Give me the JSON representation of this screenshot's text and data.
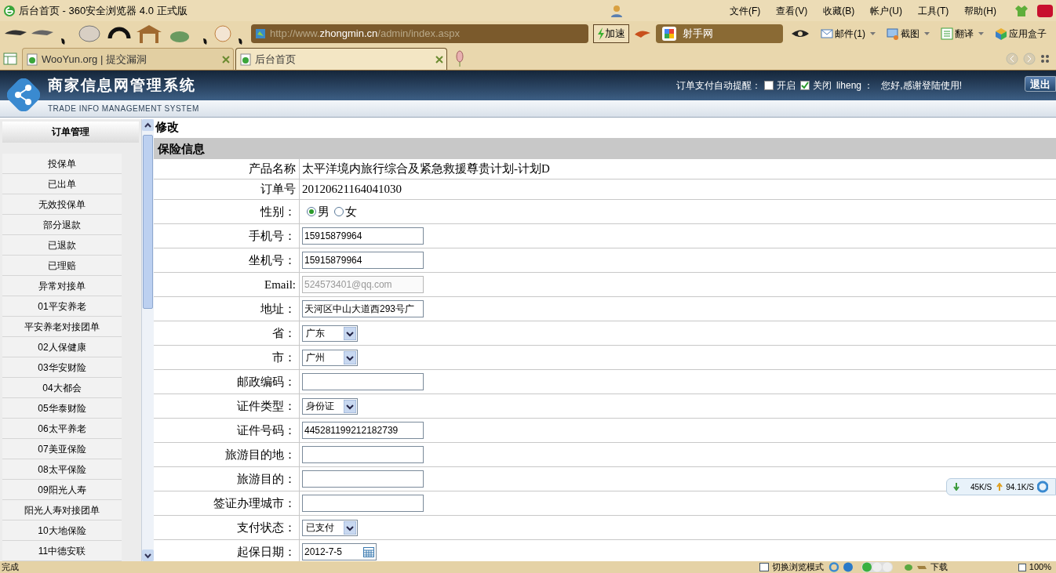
{
  "window": {
    "title": "后台首页 - 360安全浏览器 4.0 正式版"
  },
  "menu": [
    "文件(F)",
    "查看(V)",
    "收藏(B)",
    "帐户(U)",
    "工具(T)",
    "帮助(H)"
  ],
  "toolbar": {
    "address": {
      "prefix": "http://www.",
      "domain": "zhongmin.cn",
      "path": "/admin/index.aspx"
    },
    "speedup": "加速",
    "search": "射手网",
    "tools": [
      {
        "label": "邮件(1)",
        "dropdown": true
      },
      {
        "label": "截图",
        "dropdown": true
      },
      {
        "label": "翻译",
        "dropdown": true
      },
      {
        "label": "应用盒子",
        "dropdown": false
      }
    ]
  },
  "tabs": [
    {
      "label": "WooYun.org | 提交漏洞",
      "selected": false
    },
    {
      "label": "后台首页",
      "selected": true
    }
  ],
  "header": {
    "title": "商家信息网管理系统",
    "subtitle": "TRADE INFO MANAGEMENT SYSTEM",
    "reminder_label": "订单支付自动提醒：",
    "options": [
      {
        "label": "开启",
        "checked": false
      },
      {
        "label": "关闭",
        "checked": true
      }
    ],
    "user": "liheng ：",
    "greeting": "您好,感谢登陆使用!",
    "logout": "退出"
  },
  "sidebar": {
    "title": "订单管理",
    "items": [
      "投保单",
      "已出单",
      "无效投保单",
      "部分退款",
      "已退款",
      "已理赔",
      "异常对接单",
      "01平安养老",
      "平安养老对接团单",
      "02人保健康",
      "03华安财险",
      "04大都会",
      "05华泰财险",
      "06太平养老",
      "07美亚保险",
      "08太平保险",
      "09阳光人寿",
      "阳光人寿对接团单",
      "10大地保险",
      "11中德安联"
    ]
  },
  "main": {
    "title": "修改",
    "section": "保险信息",
    "rows": [
      {
        "kind": "text",
        "label": "产品名称",
        "value": "太平洋境内旅行综合及紧急救援尊贵计划-计划D"
      },
      {
        "kind": "text",
        "label": "订单号",
        "value": "20120621164041030"
      },
      {
        "kind": "radio",
        "label": "性别：",
        "options": [
          {
            "label": "男",
            "selected": true
          },
          {
            "label": "女",
            "selected": false
          }
        ]
      },
      {
        "kind": "input",
        "label": "手机号：",
        "value": "15915879964",
        "disabled": false
      },
      {
        "kind": "input",
        "label": "坐机号：",
        "value": "15915879964",
        "disabled": false
      },
      {
        "kind": "input",
        "label": "Email:",
        "value": "524573401@qq.com",
        "disabled": true
      },
      {
        "kind": "input",
        "label": "地址：",
        "value": "天河区中山大道西293号广",
        "disabled": false
      },
      {
        "kind": "select",
        "label": "省：",
        "value": "广东"
      },
      {
        "kind": "select",
        "label": "市：",
        "value": "广州"
      },
      {
        "kind": "input",
        "label": "邮政编码：",
        "disabled": false
      },
      {
        "kind": "select",
        "label": "证件类型：",
        "value": "身份证"
      },
      {
        "kind": "input",
        "label": "证件号码：",
        "value": "445281199212182739",
        "disabled": false
      },
      {
        "kind": "input",
        "label": "旅游目的地：",
        "disabled": false
      },
      {
        "kind": "input",
        "label": "旅游目的：",
        "disabled": false
      },
      {
        "kind": "input",
        "label": "签证办理城市：",
        "disabled": false
      },
      {
        "kind": "select",
        "label": "支付状态：",
        "value": "已支付"
      },
      {
        "kind": "date",
        "label": "起保日期：",
        "value": "2012-7-5"
      }
    ]
  },
  "transfer": {
    "down": "45K/S",
    "up": "94.1K/S"
  },
  "status_bar": {
    "text": "完成",
    "items": [
      "切换浏览模式",
      "下载",
      "100%"
    ]
  }
}
